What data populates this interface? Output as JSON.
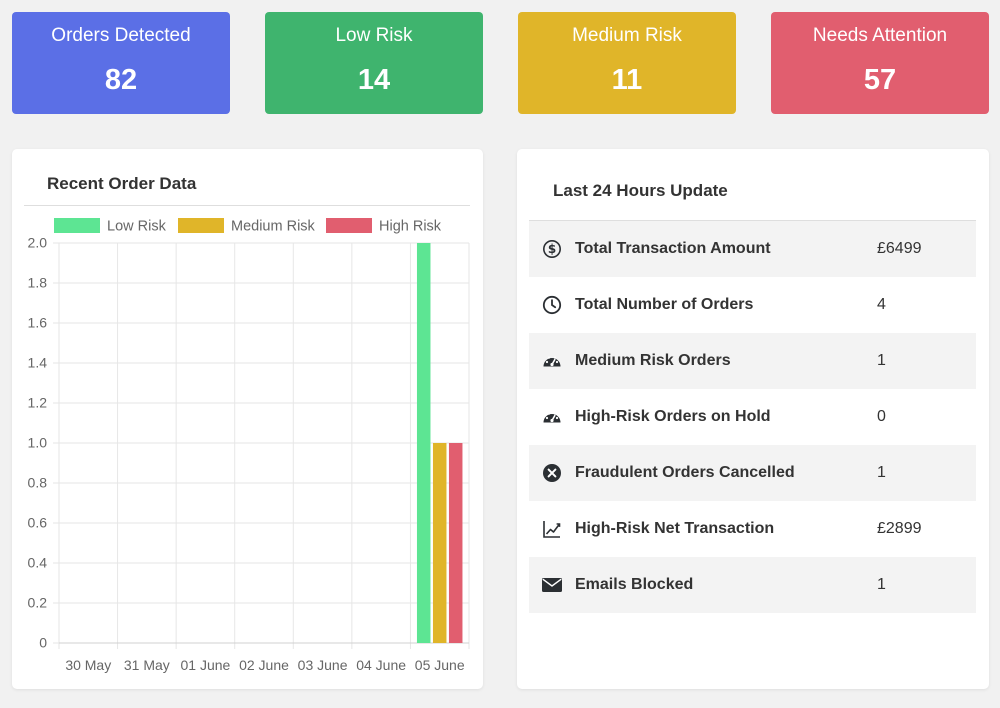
{
  "stats": [
    {
      "label": "Orders Detected",
      "value": "82",
      "color": "#5b6fe6"
    },
    {
      "label": "Low Risk",
      "value": "14",
      "color": "#3fb46e"
    },
    {
      "label": "Medium Risk",
      "value": "11",
      "color": "#e0b529"
    },
    {
      "label": "Needs Attention",
      "value": "57",
      "color": "#e15e6f"
    }
  ],
  "recent_orders": {
    "title": "Recent Order Data"
  },
  "chart_data": {
    "type": "bar",
    "categories": [
      "30 May",
      "31 May",
      "01 June",
      "02 June",
      "03 June",
      "04 June",
      "05 June"
    ],
    "series": [
      {
        "name": "Low Risk",
        "color": "#5de593",
        "values": [
          0,
          0,
          0,
          0,
          0,
          0,
          2
        ]
      },
      {
        "name": "Medium Risk",
        "color": "#e0b529",
        "values": [
          0,
          0,
          0,
          0,
          0,
          0,
          1
        ]
      },
      {
        "name": "High Risk",
        "color": "#e15e6f",
        "values": [
          0,
          0,
          0,
          0,
          0,
          0,
          1
        ]
      }
    ],
    "yticks": [
      "0",
      "0.2",
      "0.4",
      "0.6",
      "0.8",
      "1.0",
      "1.2",
      "1.4",
      "1.6",
      "1.8",
      "2.0"
    ],
    "ylim": [
      0,
      2
    ],
    "grid": true,
    "legend": "top"
  },
  "last24": {
    "title": "Last 24 Hours Update",
    "rows": [
      {
        "icon": "dollar-circle-icon",
        "label": "Total Transaction Amount",
        "value": "£6499"
      },
      {
        "icon": "clock-icon",
        "label": "Total Number of Orders",
        "value": "4"
      },
      {
        "icon": "speedometer-icon",
        "label": "Medium Risk Orders",
        "value": "1"
      },
      {
        "icon": "speedometer-icon",
        "label": "High-Risk Orders on Hold",
        "value": "0"
      },
      {
        "icon": "x-circle-icon",
        "label": "Fraudulent Orders Cancelled",
        "value": "1"
      },
      {
        "icon": "graph-up-icon",
        "label": "High-Risk Net Transaction",
        "value": "£2899"
      },
      {
        "icon": "envelope-icon",
        "label": "Emails Blocked",
        "value": "1"
      }
    ]
  }
}
